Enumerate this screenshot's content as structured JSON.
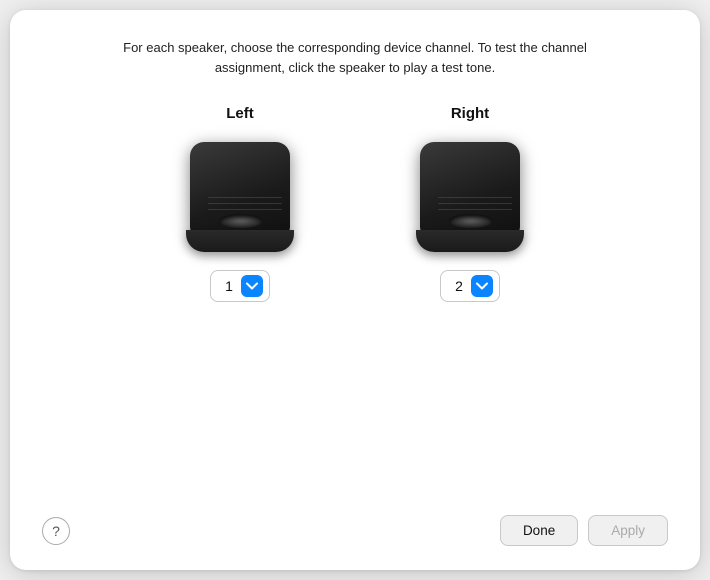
{
  "dialog": {
    "description": "For each speaker, choose the corresponding device channel. To test the channel assignment, click the speaker to play a test tone.",
    "left_speaker": {
      "label": "Left",
      "channel_value": "1"
    },
    "right_speaker": {
      "label": "Right",
      "channel_value": "2"
    },
    "footer": {
      "help_label": "?",
      "done_label": "Done",
      "apply_label": "Apply"
    }
  }
}
